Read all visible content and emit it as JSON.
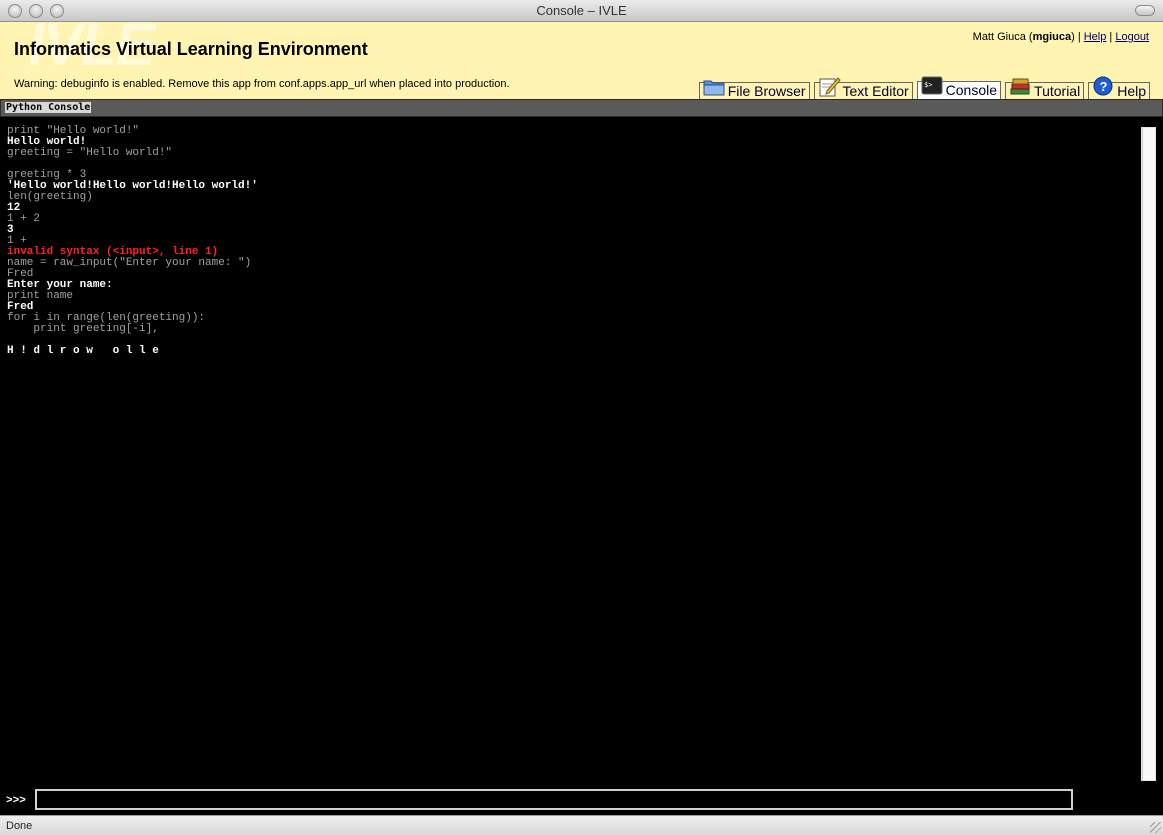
{
  "window": {
    "title": "Console – IVLE"
  },
  "header": {
    "logo_watermark": "IVLE",
    "app_title": "Informatics Virtual Learning Environment",
    "warning": "Warning: debuginfo is enabled. Remove this app from conf.apps.app_url when placed into production.",
    "user": {
      "name": "Matt Giuca",
      "login": "mgiuca",
      "help_label": "Help",
      "logout_label": "Logout"
    }
  },
  "tabs": [
    {
      "label": "File Browser",
      "icon": "folder-icon",
      "active": false
    },
    {
      "label": "Text Editor",
      "icon": "pencil-icon",
      "active": false
    },
    {
      "label": "Console",
      "icon": "terminal-icon",
      "active": true
    },
    {
      "label": "Tutorial",
      "icon": "books-icon",
      "active": false
    },
    {
      "label": "Help",
      "icon": "help-icon",
      "active": false
    }
  ],
  "console": {
    "heading": "Python Console",
    "lines": [
      {
        "kind": "cmd",
        "text": "print \"Hello world!\""
      },
      {
        "kind": "out",
        "text": "Hello world!"
      },
      {
        "kind": "cmd",
        "text": "greeting = \"Hello world!\""
      },
      {
        "kind": "cmd",
        "text": ""
      },
      {
        "kind": "cmd",
        "text": "greeting * 3"
      },
      {
        "kind": "out",
        "text": "'Hello world!Hello world!Hello world!'"
      },
      {
        "kind": "cmd",
        "text": "len(greeting)"
      },
      {
        "kind": "out",
        "text": "12"
      },
      {
        "kind": "cmd",
        "text": "1 + 2"
      },
      {
        "kind": "out",
        "text": "3"
      },
      {
        "kind": "cmd",
        "text": "1 +"
      },
      {
        "kind": "err",
        "text": "invalid syntax (<input>, line 1)"
      },
      {
        "kind": "cmd",
        "text": "name = raw_input(\"Enter your name: \")"
      },
      {
        "kind": "cmd",
        "text": "Fred"
      },
      {
        "kind": "out",
        "text": "Enter your name:"
      },
      {
        "kind": "cmd",
        "text": "print name"
      },
      {
        "kind": "out",
        "text": "Fred"
      },
      {
        "kind": "cmd",
        "text": "for i in range(len(greeting)):"
      },
      {
        "kind": "cmd",
        "text": "    print greeting[-i],"
      },
      {
        "kind": "cmd",
        "text": ""
      },
      {
        "kind": "out",
        "text": "H ! d l r o w   o l l e"
      }
    ],
    "prompt": ">>>",
    "input_value": ""
  },
  "statusbar": {
    "text": "Done"
  },
  "colors": {
    "header_bg": "#fff4b2",
    "console_bg": "#000000",
    "error": "#ff2020",
    "command": "#a0a0a0"
  }
}
